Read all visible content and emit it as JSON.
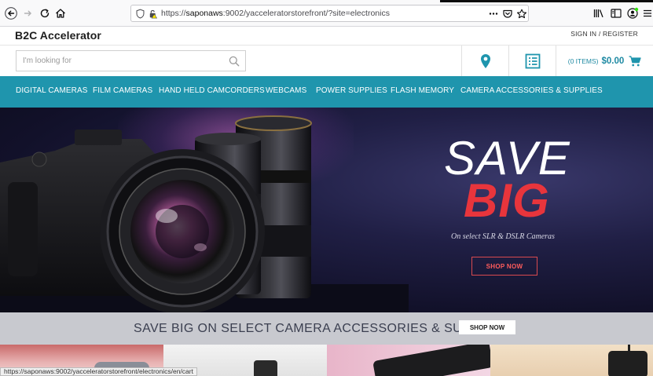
{
  "browser": {
    "url_prefix": "https://",
    "url_host": "saponaws",
    "url_rest": ":9002/yacceleratorstorefront/?site=electronics",
    "more_icon": "ellipsis-icon",
    "status_url": "https://saponaws:9002/yacceleratorstorefront/electronics/en/cart"
  },
  "header": {
    "logo": "B2C Accelerator",
    "sign_in": "SIGN IN / REGISTER"
  },
  "search": {
    "placeholder": "I'm looking for"
  },
  "cart": {
    "items_label": "(0 ITEMS)",
    "total": "$0.00"
  },
  "nav": {
    "items": [
      {
        "label": "DIGITAL CAMERAS"
      },
      {
        "label": "FILM CAMERAS"
      },
      {
        "label": "HAND HELD CAMCORDERS"
      },
      {
        "label": "WEBCAMS"
      },
      {
        "label": "POWER SUPPLIES"
      },
      {
        "label": "FLASH MEMORY"
      },
      {
        "label": "CAMERA ACCESSORIES & SUPPLIES"
      }
    ]
  },
  "hero": {
    "line1": "SAVE",
    "line2": "BIG",
    "subtitle": "On select SLR & DSLR Cameras",
    "button": "SHOP NOW"
  },
  "promo": {
    "text": "SAVE BIG ON SELECT CAMERA ACCESSORIES & SUPPLIES",
    "button": "SHOP NOW"
  },
  "colors": {
    "accent": "#1f95ad",
    "cart_text": "#1f8aa3",
    "hero_red": "#e8353c"
  }
}
